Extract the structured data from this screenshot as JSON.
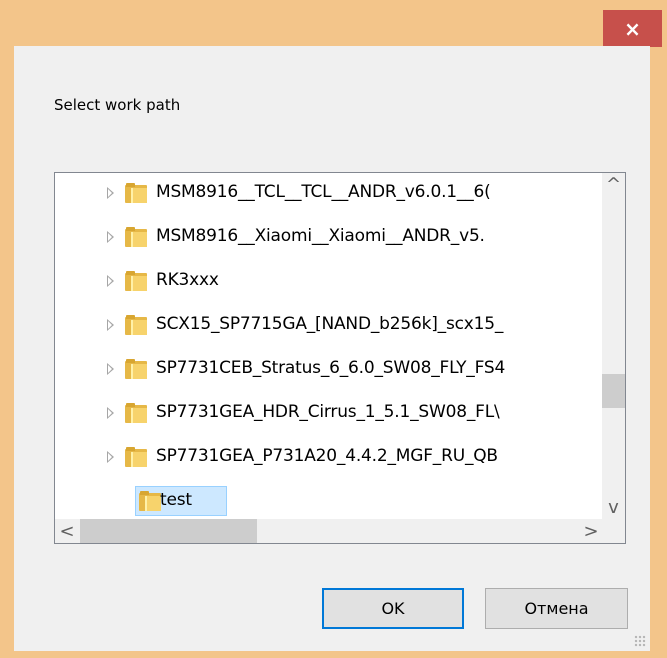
{
  "window": {
    "close_symbol": "×"
  },
  "dialog": {
    "prompt": "Select work path"
  },
  "tree": {
    "items": [
      {
        "label": "MSM8916__TCL__TCL__ANDR_v6.0.1__6("
      },
      {
        "label": "MSM8916__Xiaomi__Xiaomi__ANDR_v5."
      },
      {
        "label": "RK3xxx"
      },
      {
        "label": "SCX15_SP7715GA_[NAND_b256k]_scx15_"
      },
      {
        "label": "SP7731CEB_Stratus_6_6.0_SW08_FLY_FS4"
      },
      {
        "label": "SP7731GEA_HDR_Cirrus_1_5.1_SW08_FL\\"
      },
      {
        "label": "SP7731GEA_P731A20_4.4.2_MGF_RU_QB"
      }
    ],
    "selected_label": "test"
  },
  "scroll": {
    "up": "^",
    "down": "v",
    "left": "<",
    "right": ">"
  },
  "buttons": {
    "ok": "OK",
    "cancel": "Отмена"
  },
  "icons": {
    "close": "close-icon",
    "folder": "folder-icon",
    "expand": "chevron-right-icon",
    "resize_grip": "resize-grip-icon"
  }
}
